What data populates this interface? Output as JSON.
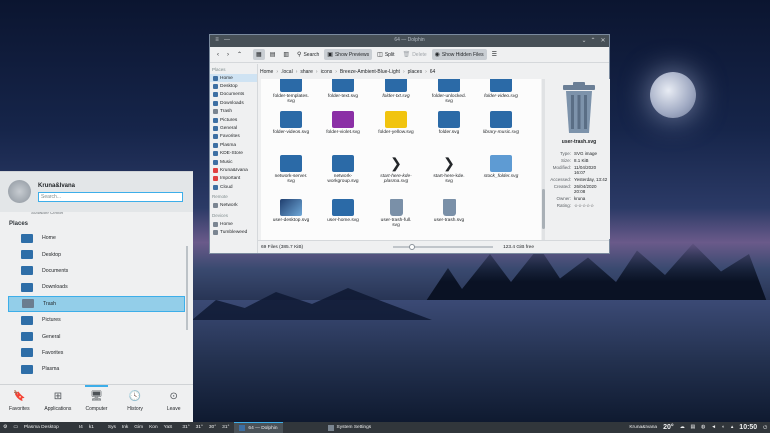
{
  "dolphin": {
    "title": "64 — Dolphin",
    "toolbar": {
      "search": "Search",
      "show_previews": "Show Previews",
      "split": "Split",
      "delete": "Delete",
      "show_hidden": "Show Hidden Files"
    },
    "places_header": "Places",
    "places": [
      "Home",
      "Desktop",
      "Documents",
      "Downloads",
      "Trash",
      "Pictures",
      "General",
      "Favorites",
      "Plasma",
      "KDE-Store",
      "Music",
      "Kruna&Ivana",
      "Important",
      "Cloud"
    ],
    "remote_header": "Remote",
    "remote": [
      "Network"
    ],
    "devices_header": "Devices",
    "devices": [
      "Home",
      "Tumbleweed"
    ],
    "breadcrumb": [
      "Home",
      ".local",
      "share",
      "icons",
      "Breeze-Ambient-Blue-Light",
      "places",
      "64"
    ],
    "files": [
      {
        "name": "folder-templates.\nsvg",
        "kind": "folder"
      },
      {
        "name": "folder-text.svg",
        "kind": "folder"
      },
      {
        "name": "folder-txt.svg",
        "kind": "folder",
        "italic": true
      },
      {
        "name": "folder-unlocked.\nsvg",
        "kind": "folder"
      },
      {
        "name": "folder-video.svg",
        "kind": "folder",
        "italic": true
      },
      {
        "name": "folder-videos.svg",
        "kind": "folder"
      },
      {
        "name": "folder-violet.svg",
        "kind": "violet"
      },
      {
        "name": "folder-yellow.svg",
        "kind": "yellow"
      },
      {
        "name": "folder.svg",
        "kind": "folder"
      },
      {
        "name": "library-music.svg",
        "kind": "folder",
        "italic": true
      },
      {
        "name": "network-server.\nsvg",
        "kind": "folder"
      },
      {
        "name": "network-\nworkgroup.svg",
        "kind": "folder"
      },
      {
        "name": "start-here-kde-\nplasma.svg",
        "kind": "kde",
        "italic": true
      },
      {
        "name": "start-here-kde.\nsvg",
        "kind": "kde"
      },
      {
        "name": "stock_folder.svg",
        "kind": "light",
        "italic": true
      },
      {
        "name": "user-desktop.svg",
        "kind": "img"
      },
      {
        "name": "user-home.svg",
        "kind": "folder"
      },
      {
        "name": "user-trash-full.\nsvg",
        "kind": "trash"
      },
      {
        "name": "user-trash.svg",
        "kind": "trash"
      }
    ],
    "info": {
      "name": "user-trash.svg",
      "rows": [
        {
          "k": "Type:",
          "v": "SVG image"
        },
        {
          "k": "Size:",
          "v": "8.1 KiB"
        },
        {
          "k": "Modified:",
          "v": "11/04/2020\n16:07"
        },
        {
          "k": "Accessed:",
          "v": "Yesterday, 13:42"
        },
        {
          "k": "Created:",
          "v": "26/04/2020\n20:08"
        },
        {
          "k": "Owner:",
          "v": "kruna"
        },
        {
          "k": "Rating:",
          "v": "☆☆☆☆☆"
        }
      ]
    },
    "status_left": "69 Files (385.7 KiB)",
    "status_right": "123.4 GiB free"
  },
  "launcher": {
    "user": "Kruna&Ivana",
    "search_placeholder": "Search...",
    "partial_item": "Software Center",
    "places_header": "Places",
    "items": [
      "Home",
      "Desktop",
      "Documents",
      "Downloads",
      "Trash",
      "Pictures",
      "General",
      "Favorites",
      "Plasma"
    ],
    "selected": "Trash",
    "footer": [
      "Favorites",
      "Applications",
      "Computer",
      "History",
      "Leave"
    ]
  },
  "panel": {
    "plasma_desktop": "Plasma Desktop",
    "pager": [
      "I4",
      "k1"
    ],
    "quick": [
      "Sys",
      "Ink",
      "Gim",
      "Kon",
      "YaS"
    ],
    "temps": [
      "31°",
      "31°",
      "30°",
      "31°"
    ],
    "tasks": [
      "64 — Dolphin",
      "System Settings"
    ],
    "user": "Kruna&Ivana",
    "weather": "20°",
    "clock": "10:50"
  },
  "colors": {
    "accent": "#3daee9",
    "panel": "#31363b",
    "folder": "#2b6aa7"
  }
}
